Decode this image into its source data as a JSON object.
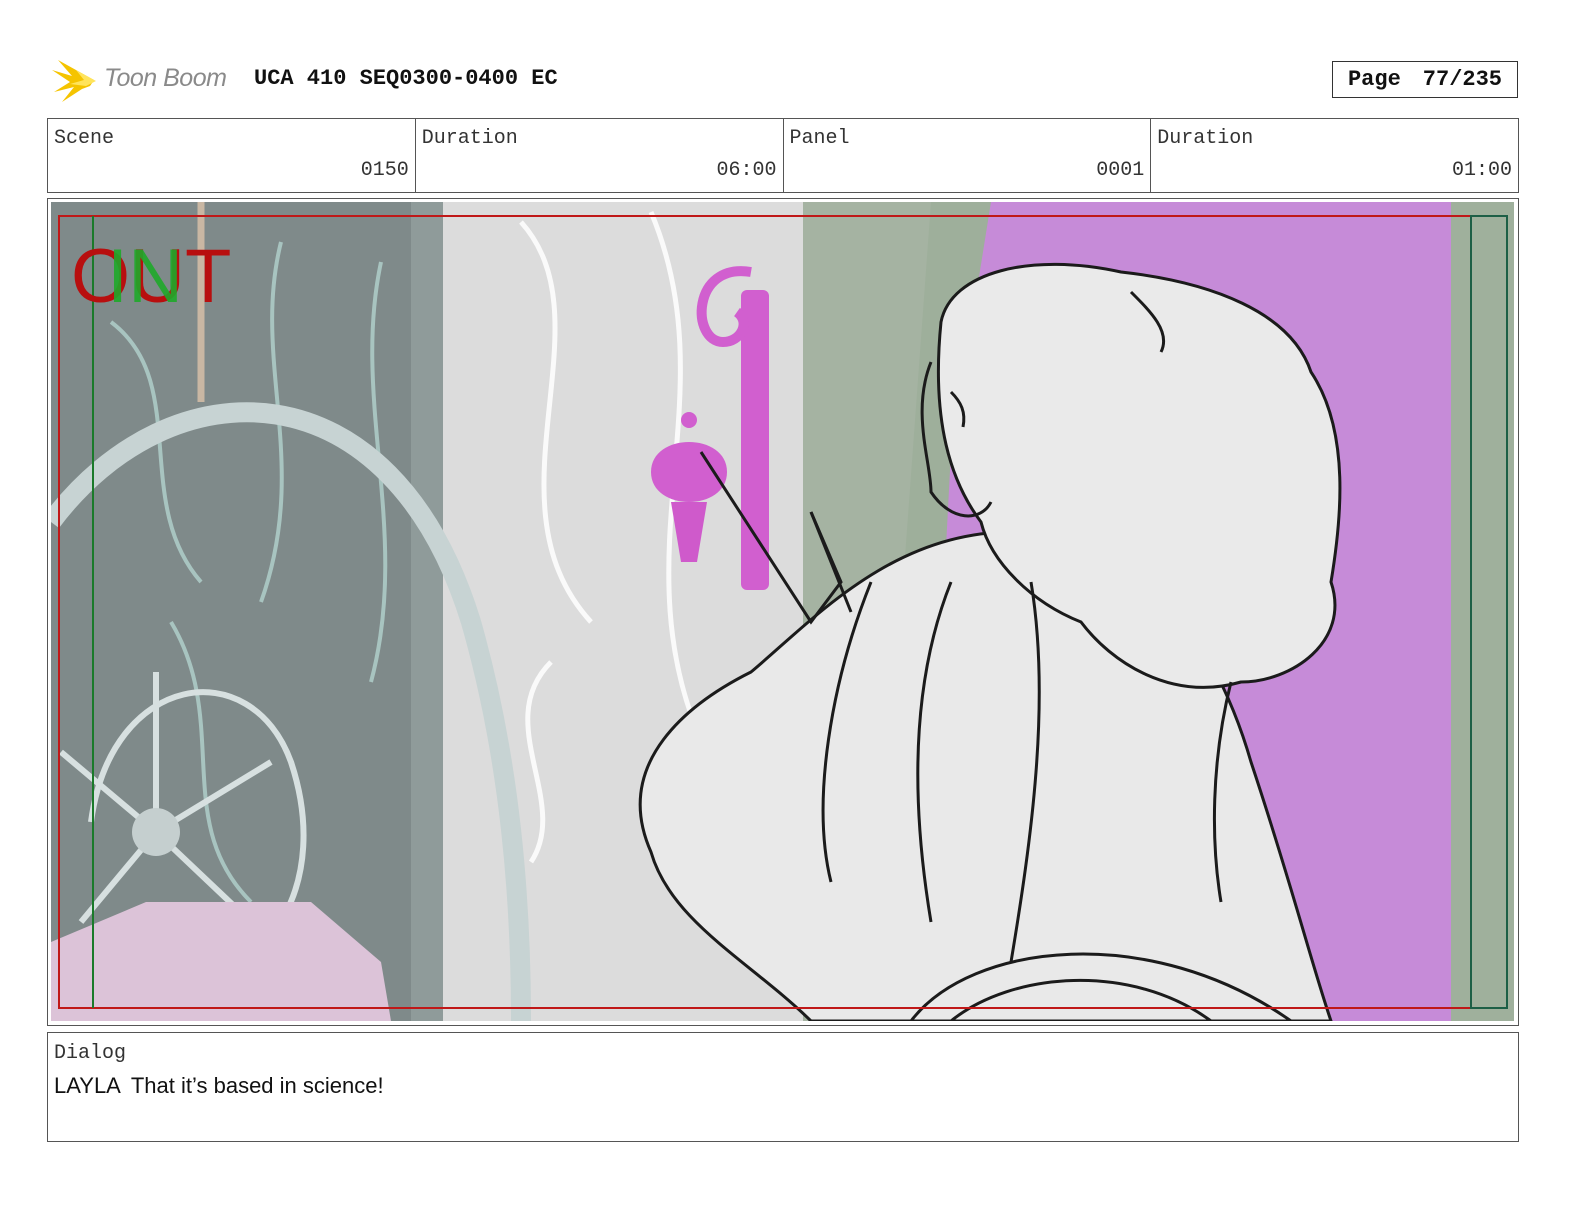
{
  "header": {
    "logo_text": "Toon Boom",
    "title": "UCA 410 SEQ0300-0400 EC",
    "page_label": "Page",
    "page_value": "77/235"
  },
  "info": {
    "scene_label": "Scene",
    "scene_value": "0150",
    "scene_duration_label": "Duration",
    "scene_duration_value": "06:00",
    "panel_label": "Panel",
    "panel_value": "0001",
    "panel_duration_label": "Duration",
    "panel_duration_value": "01:00"
  },
  "panel_image": {
    "overlay_out": "OUT",
    "overlay_in": "IN",
    "colors": {
      "out_text": "#b80f0f",
      "in_text": "#1faa2a",
      "safe_frame": "#c01818",
      "green_guide": "#1a7a2a",
      "purple_wall": "#c586d6",
      "lamp": "#d45cd0"
    }
  },
  "dialog": {
    "label": "Dialog",
    "speaker": "LAYLA",
    "line": "That it’s based in science!"
  }
}
